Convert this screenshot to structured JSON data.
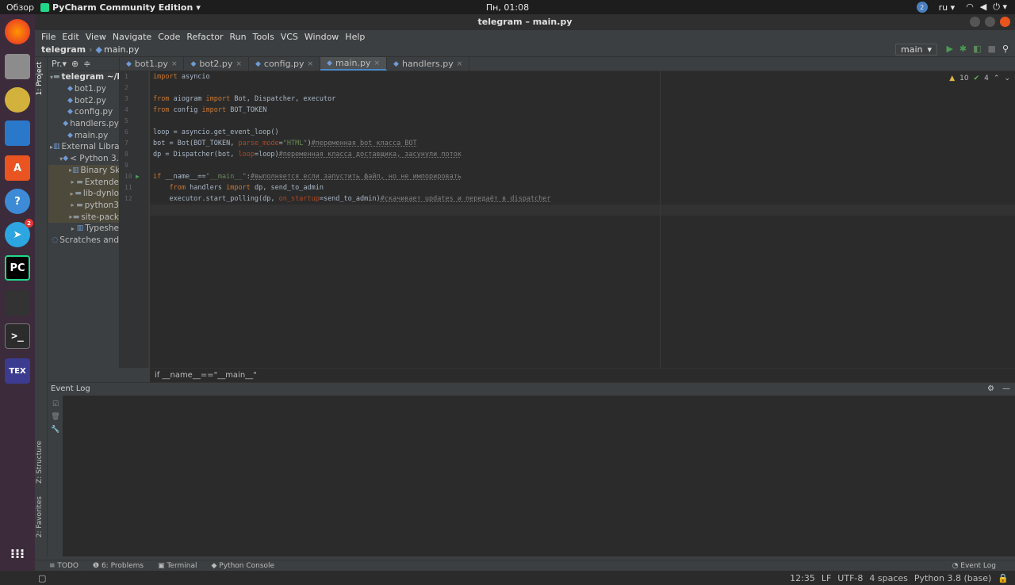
{
  "os": {
    "activities": "Обзор",
    "app_name": "PyCharm Community Edition",
    "clock": "Пн, 01:08",
    "lang": "ru",
    "notif_badge": "2"
  },
  "dock": {
    "telegram_badge": "2",
    "pycharm_label": "PC",
    "tex_label": "TEX"
  },
  "window": {
    "title": "telegram – main.py"
  },
  "menu": [
    "File",
    "Edit",
    "View",
    "Navigate",
    "Code",
    "Refactor",
    "Run",
    "Tools",
    "VCS",
    "Window",
    "Help"
  ],
  "nav": {
    "project": "telegram",
    "file": "main.py",
    "run_config": "main"
  },
  "left_tabs": {
    "project": "1: Project",
    "structure": "Z: Structure",
    "favorites": "2: Favorites"
  },
  "project_panel": {
    "header": "Pr.▾",
    "tree": [
      {
        "label": "telegram ~/P",
        "depth": 0,
        "arrow": "▾",
        "bold": true,
        "lib": false,
        "icon": "folder"
      },
      {
        "label": "bot1.py",
        "depth": 1,
        "arrow": "",
        "bold": false,
        "lib": false,
        "icon": "py"
      },
      {
        "label": "bot2.py",
        "depth": 1,
        "arrow": "",
        "bold": false,
        "lib": false,
        "icon": "py"
      },
      {
        "label": "config.py",
        "depth": 1,
        "arrow": "",
        "bold": false,
        "lib": false,
        "icon": "py"
      },
      {
        "label": "handlers.py",
        "depth": 1,
        "arrow": "",
        "bold": false,
        "lib": false,
        "icon": "py"
      },
      {
        "label": "main.py",
        "depth": 1,
        "arrow": "",
        "bold": false,
        "lib": false,
        "icon": "py"
      },
      {
        "label": "External Libra",
        "depth": 0,
        "arrow": "▸",
        "bold": false,
        "lib": false,
        "icon": "lib"
      },
      {
        "label": "< Python 3.",
        "depth": 1,
        "arrow": "▾",
        "bold": false,
        "lib": false,
        "icon": "py"
      },
      {
        "label": "Binary Sk",
        "depth": 2,
        "arrow": "▸",
        "bold": false,
        "lib": true,
        "icon": "lib"
      },
      {
        "label": "Extende",
        "depth": 2,
        "arrow": "▸",
        "bold": false,
        "lib": true,
        "icon": "folder"
      },
      {
        "label": "lib-dynlo",
        "depth": 2,
        "arrow": "▸",
        "bold": false,
        "lib": true,
        "icon": "folder"
      },
      {
        "label": "python3",
        "depth": 2,
        "arrow": "▸",
        "bold": false,
        "lib": true,
        "icon": "folder"
      },
      {
        "label": "site-pack",
        "depth": 2,
        "arrow": "▸",
        "bold": false,
        "lib": true,
        "icon": "folder"
      },
      {
        "label": "Typeshe",
        "depth": 2,
        "arrow": "▸",
        "bold": false,
        "lib": false,
        "icon": "lib"
      },
      {
        "label": "Scratches and",
        "depth": 0,
        "arrow": "",
        "bold": false,
        "lib": false,
        "icon": "scratch"
      }
    ]
  },
  "tabs": [
    {
      "label": "bot1.py",
      "active": false
    },
    {
      "label": "bot2.py",
      "active": false
    },
    {
      "label": "config.py",
      "active": false
    },
    {
      "label": "main.py",
      "active": true
    },
    {
      "label": "handlers.py",
      "active": false
    }
  ],
  "inspection": {
    "warnings": "10",
    "weak": "4"
  },
  "code_lines": [
    {
      "n": "1",
      "run": false,
      "parts": [
        {
          "t": "import",
          "c": "kw"
        },
        {
          "t": " asyncio",
          "c": ""
        }
      ]
    },
    {
      "n": "2",
      "run": false,
      "parts": []
    },
    {
      "n": "3",
      "run": false,
      "parts": [
        {
          "t": "from",
          "c": "kw"
        },
        {
          "t": " aiogram ",
          "c": ""
        },
        {
          "t": "import",
          "c": "kw"
        },
        {
          "t": " Bot, Dispatcher, executor",
          "c": ""
        }
      ]
    },
    {
      "n": "4",
      "run": false,
      "parts": [
        {
          "t": "from",
          "c": "kw"
        },
        {
          "t": " config ",
          "c": ""
        },
        {
          "t": "import",
          "c": "kw"
        },
        {
          "t": " BOT_TOKEN",
          "c": ""
        }
      ]
    },
    {
      "n": "5",
      "run": false,
      "parts": []
    },
    {
      "n": "6",
      "run": false,
      "parts": [
        {
          "t": "loop = asyncio.get_event_loop()",
          "c": ""
        }
      ]
    },
    {
      "n": "7",
      "run": false,
      "parts": [
        {
          "t": "bot = Bot(BOT_TOKEN, ",
          "c": ""
        },
        {
          "t": "parse_mode",
          "c": "pm"
        },
        {
          "t": "=",
          "c": ""
        },
        {
          "t": "\"HTML\"",
          "c": "st"
        },
        {
          "t": ")",
          "c": ""
        },
        {
          "t": "#переменная bot класса BOT",
          "c": "cm"
        }
      ]
    },
    {
      "n": "8",
      "run": false,
      "parts": [
        {
          "t": "dp = Dispatcher(bot, ",
          "c": ""
        },
        {
          "t": "loop",
          "c": "pm"
        },
        {
          "t": "=loop)",
          "c": ""
        },
        {
          "t": "#переменная класса доставщика, засунули поток",
          "c": "cm"
        }
      ]
    },
    {
      "n": "9",
      "run": false,
      "parts": []
    },
    {
      "n": "10",
      "run": true,
      "parts": [
        {
          "t": "if",
          "c": "kw"
        },
        {
          "t": " __name__==",
          "c": ""
        },
        {
          "t": "\"__main__\"",
          "c": "st"
        },
        {
          "t": ":",
          "c": ""
        },
        {
          "t": "#выполняется если запустить файл, но не импорировать",
          "c": "cm"
        }
      ]
    },
    {
      "n": "11",
      "run": false,
      "parts": [
        {
          "t": "    ",
          "c": ""
        },
        {
          "t": "from",
          "c": "kw"
        },
        {
          "t": " handlers ",
          "c": ""
        },
        {
          "t": "import",
          "c": "kw"
        },
        {
          "t": " dp, send_to_admin",
          "c": ""
        }
      ]
    },
    {
      "n": "12",
      "run": false,
      "parts": [
        {
          "t": "    executor.start_polling(dp, ",
          "c": ""
        },
        {
          "t": "on_startup",
          "c": "pm"
        },
        {
          "t": "=send_to_admin)",
          "c": ""
        },
        {
          "t": "#скачивает updates и передаёт в dispatcher",
          "c": "cm"
        }
      ]
    }
  ],
  "breadcrumb_text": "if __name__==\"__main__\"",
  "event_log": {
    "title": "Event Log"
  },
  "bottom_tools": [
    "TODO",
    "6: Problems",
    "Terminal",
    "Python Console"
  ],
  "bottom_event_log": "Event Log",
  "status": {
    "position": "12:35",
    "line_sep": "LF",
    "encoding": "UTF-8",
    "indent": "4 spaces",
    "interpreter": "Python 3.8 (base)"
  }
}
